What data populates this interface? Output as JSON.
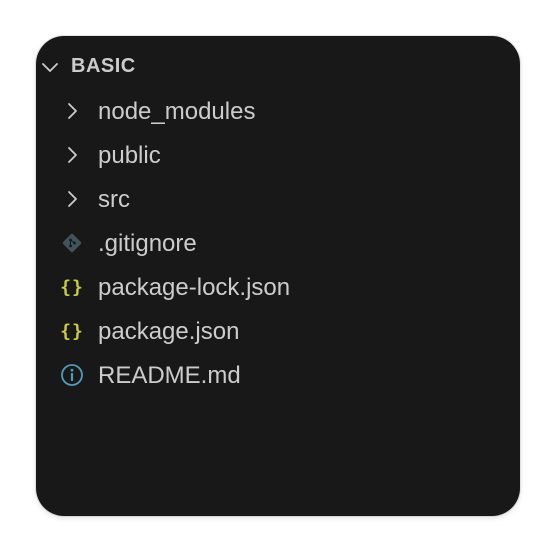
{
  "explorer": {
    "section_title": "BASIC",
    "items": [
      {
        "label": "node_modules",
        "type": "folder",
        "icon": "chevron-right-icon"
      },
      {
        "label": "public",
        "type": "folder",
        "icon": "chevron-right-icon"
      },
      {
        "label": "src",
        "type": "folder",
        "icon": "chevron-right-icon"
      },
      {
        "label": ".gitignore",
        "type": "file",
        "icon": "git-icon"
      },
      {
        "label": "package-lock.json",
        "type": "file",
        "icon": "json-braces-icon",
        "icon_text": "{}"
      },
      {
        "label": "package.json",
        "type": "file",
        "icon": "json-braces-icon",
        "icon_text": "{}"
      },
      {
        "label": "README.md",
        "type": "file",
        "icon": "info-icon"
      }
    ]
  },
  "colors": {
    "panel_background": "#181818",
    "text": "#cccccc",
    "json_icon": "#cbcb41",
    "info_icon": "#519aba",
    "git_icon": "#41535b"
  }
}
